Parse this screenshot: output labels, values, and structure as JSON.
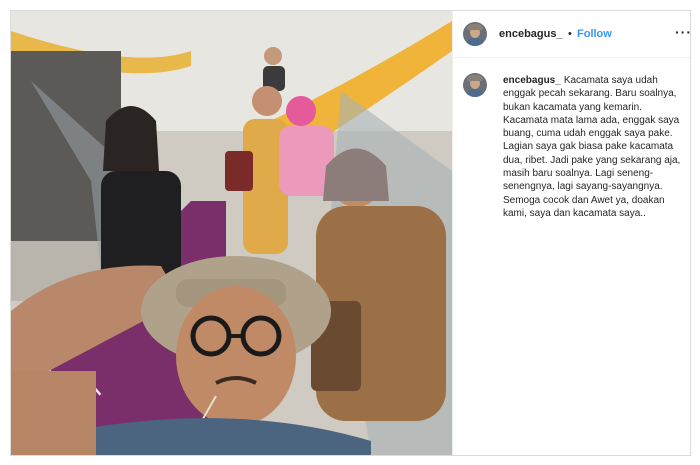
{
  "post": {
    "username": "encebagus_",
    "separator": "•",
    "follow_label": "Follow",
    "more_label": "···",
    "caption_username": "encebagus_",
    "caption_text": "Kacamata saya udah enggak pecah sekarang. Baru soalnya, bukan kacamata yang kemarin. Kacamata mata lama ada, enggak saya buang, cuma udah enggak saya pake. Lagian saya gak biasa pake kacamata dua, ribet. Jadi pake yang sekarang aja, masih baru soalnya. Lagi seneng-senengnya, lagi sayang-sayangnya. Semoga cocok dan Awet ya, doakan kami, saya dan kacamata saya.."
  },
  "photo": {
    "description_icons": [
      "escalator",
      "selfie-man-glasses-hat",
      "four-women"
    ]
  },
  "colors": {
    "follow": "#3897f0",
    "border": "#dbdbdb",
    "text": "#262626"
  }
}
